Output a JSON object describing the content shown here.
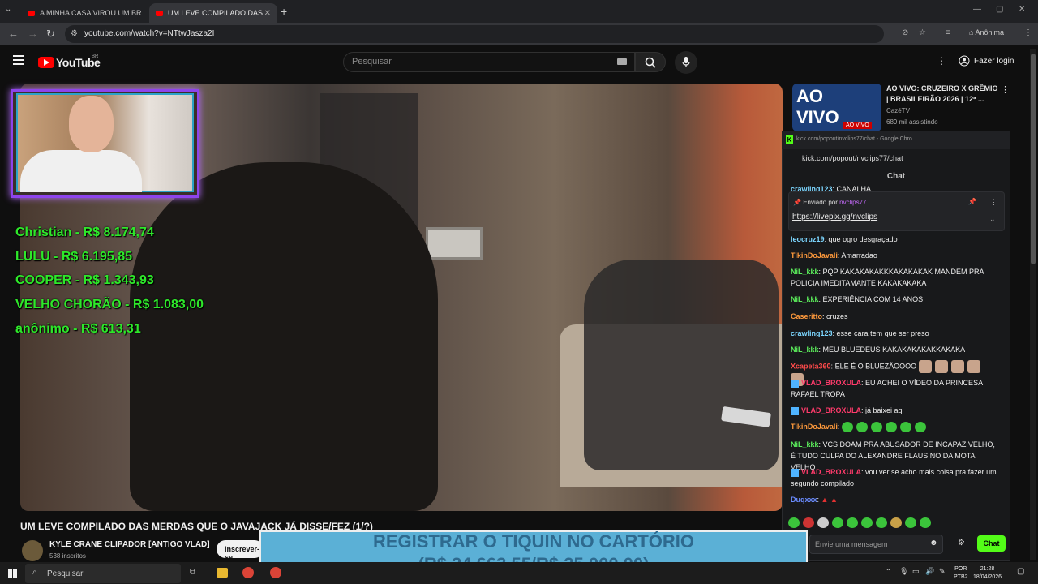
{
  "browser": {
    "tabs": [
      {
        "label": "A MINHA CASA VIROU UM BR..."
      },
      {
        "label": "UM LEVE COMPILADO DAS",
        "active": true
      }
    ],
    "url": "youtube.com/watch?v=NTtwJasza2I",
    "incognito_label": "Anônima"
  },
  "youtube": {
    "logo_text": "YouTube",
    "country": "BR",
    "search_placeholder": "Pesquisar",
    "login_label": "Fazer login",
    "video_title": "UM LEVE COMPILADO DAS MERDAS QUE O JAVAJACK JÁ DISSE/FEZ (1/?)",
    "channel_name": "KYLE CRANE CLIPADOR [ANTIGO VLAD]",
    "subscribers": "538 inscritos",
    "subscribe_label": "Inscrever-se"
  },
  "suggested": {
    "thumb_text_1": "AO",
    "thumb_text_2": "VIVO",
    "live_badge": "AO VIVO",
    "title": "AO VIVO: CRUZEIRO X GRÊMIO | BRASILEIRÃO 2026 | 12ª ...",
    "channel": "CazéTV",
    "viewers": "689 mil assistindo"
  },
  "donations": [
    "Christian - R$ 8.174,74",
    "LULU - R$ 6.195,85",
    "COOPER - R$ 1.343,93",
    "VELHO CHORÃO - R$ 1.083,00",
    "anônimo - R$ 613,31"
  ],
  "kick": {
    "window_title": "kick.com/popout/nvclips77/chat - Google Chro...",
    "url": "kick.com/popout/nvclips77/chat",
    "chat_label": "Chat",
    "pinned_head": "Enviado por",
    "pinned_user": "nvclips77",
    "pinned_link": "https://livepix.gg/nvclips",
    "input_placeholder": "Envie uma mensagem",
    "send_label": "Chat",
    "messages": [
      {
        "user": "crawling123",
        "text": "CANALHA",
        "color": "#7cd6ff"
      },
      {
        "user": "leocruz19",
        "text": "que ogro desgraçado",
        "color": "#7cd6ff"
      },
      {
        "user": "TikinDoJavali",
        "text": "Amarradao",
        "color": "#ff9a3c"
      },
      {
        "user": "NiL_kkk",
        "text": "PQP KAKAKAKAKKKAKAKAKAK MANDEM PRA POLICIA IMEDITAMANTE KAKAKAKAKA",
        "color": "#5cf05c"
      },
      {
        "user": "NiL_kkk",
        "text": "EXPERIÊNCIA COM 14 ANOS",
        "color": "#5cf05c"
      },
      {
        "user": "Caseritto",
        "text": "cruzes",
        "color": "#ff9a3c"
      },
      {
        "user": "crawling123",
        "text": "esse cara tem que ser preso",
        "color": "#7cd6ff"
      },
      {
        "user": "NiL_kkk",
        "text": "MEU BLUEDEUS KAKAKAKAKAKKAKAKA",
        "color": "#5cf05c"
      },
      {
        "user": "Xcapeta360",
        "text": "ELE É O BLUEZÃOOOO",
        "color": "#ff4b4b"
      },
      {
        "user": "VLAD_BROXULA",
        "text": "EU ACHEI O VÍDEO DA PRINCESA RAFAEL TROPA",
        "color": "#ff3b6b"
      },
      {
        "user": "VLAD_BROXULA",
        "text": "já baixei aq",
        "color": "#ff3b6b"
      },
      {
        "user": "TikinDoJavali",
        "text": "",
        "color": "#ff9a3c"
      },
      {
        "user": "NiL_kkk",
        "text": "VCS DOAM PRA ABUSADOR DE INCAPAZ VELHO, É TUDO CULPA DO ALEXANDRE FLAUSINO DA MOTA VELHO",
        "color": "#5cf05c"
      },
      {
        "user": "VLAD_BROXULA",
        "text": "vou ver se acho mais coisa pra fazer um segundo compilado",
        "color": "#ff3b6b"
      },
      {
        "user": "Duqxxx",
        "text": "",
        "color": "#6a8cff"
      }
    ]
  },
  "goal": {
    "line1": "REGISTRAR O TIQUIN NO CARTÓRIO",
    "line2": "(R$ 24.663,55/R$ 25.000,00)",
    "progress": 0.9865
  },
  "taskbar": {
    "search_label": "Pesquisar",
    "lang": "POR",
    "lang2": "PTB2",
    "time": "21:28",
    "date": "18/04/2026"
  }
}
